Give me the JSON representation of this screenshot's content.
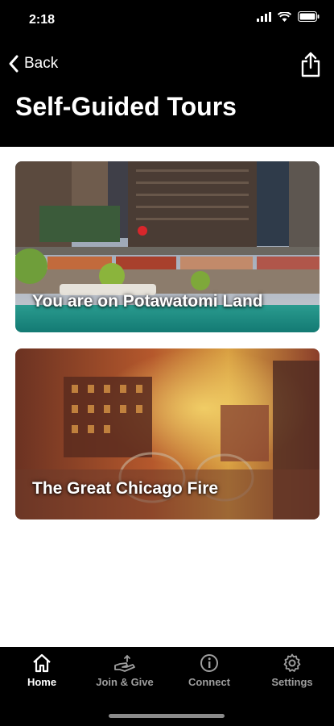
{
  "status_bar": {
    "time": "2:18",
    "icons": [
      "signal-icon",
      "wifi-icon",
      "battery-icon"
    ]
  },
  "nav": {
    "back_label": "Back",
    "share_icon": "share-icon"
  },
  "page": {
    "title": "Self-Guided Tours"
  },
  "tours": [
    {
      "label": "You are on Potawatomi Land"
    },
    {
      "label": "The Great Chicago Fire"
    }
  ],
  "tab_bar": {
    "items": [
      {
        "label": "Home",
        "icon": "home-icon",
        "active": true
      },
      {
        "label": "Join & Give",
        "icon": "hand-give-icon",
        "active": false
      },
      {
        "label": "Connect",
        "icon": "info-icon",
        "active": false
      },
      {
        "label": "Settings",
        "icon": "gear-icon",
        "active": false
      }
    ]
  },
  "colors": {
    "header_bg": "#000000",
    "tab_active": "#ffffff",
    "tab_inactive": "#9e9e9e"
  }
}
